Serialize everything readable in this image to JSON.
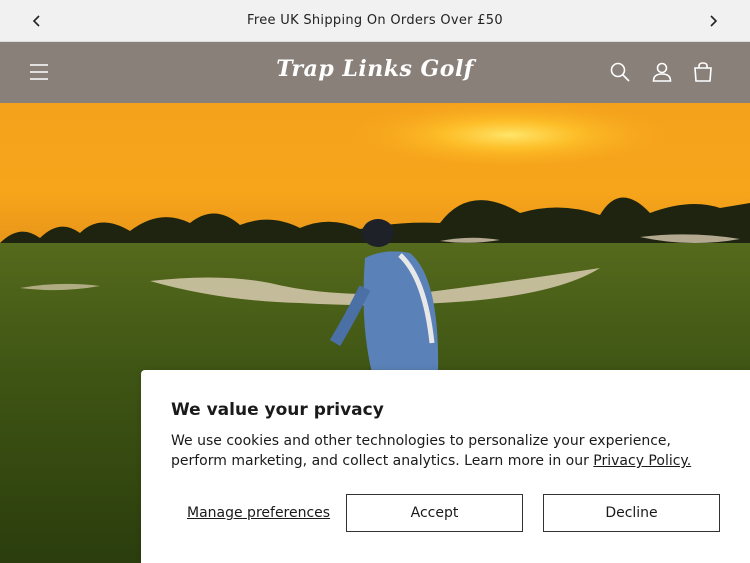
{
  "announcement": {
    "text": "Free UK Shipping On Orders Over £50"
  },
  "header": {
    "logo": "Trap Links Golf",
    "icons": [
      "menu-icon",
      "search-icon",
      "account-icon",
      "cart-icon"
    ],
    "bg_color": "#8a807a"
  },
  "cookie_banner": {
    "title": "We value your privacy",
    "body": "We use cookies and other technologies to personalize your experience, perform marketing, and collect analytics. Learn more in our",
    "policy_link": "Privacy Policy.",
    "manage_label": "Manage preferences",
    "accept_label": "Accept",
    "decline_label": "Decline"
  }
}
